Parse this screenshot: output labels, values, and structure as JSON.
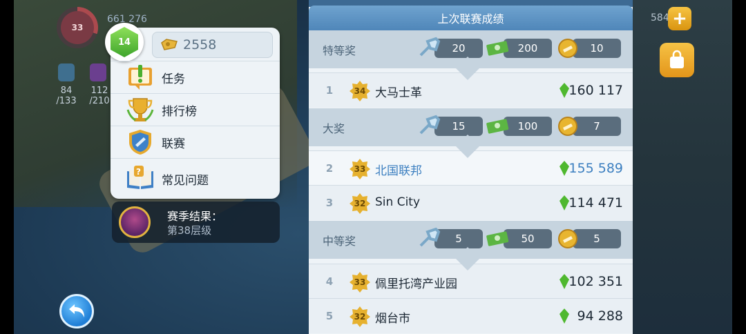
{
  "hud": {
    "player_ring_value": "33",
    "population": "661 276",
    "water_value": "84",
    "water_cap": "/133",
    "power_value": "112",
    "power_cap": "/210",
    "right_counter": "584"
  },
  "menu": {
    "level": "14",
    "currency_value": "2558",
    "items": [
      {
        "label": "任务",
        "icon": "task-icon"
      },
      {
        "label": "排行榜",
        "icon": "trophy-icon"
      },
      {
        "label": "联赛",
        "icon": "league-shield-icon"
      },
      {
        "label": "常见问题",
        "icon": "faq-book-icon"
      }
    ]
  },
  "season": {
    "title": "赛季结果：",
    "result": "第38层级"
  },
  "panel": {
    "title": "上次联赛成绩",
    "tiers": [
      {
        "name": "特等奖",
        "rewards": [
          "20",
          "200",
          "10"
        ]
      },
      {
        "name": "大奖",
        "rewards": [
          "15",
          "100",
          "7"
        ]
      },
      {
        "name": "中等奖",
        "rewards": [
          "5",
          "50",
          "5"
        ]
      }
    ],
    "rows": [
      {
        "rank": "1",
        "level": "34",
        "city": "大马士革",
        "score": "160 117",
        "highlight": false
      },
      {
        "rank": "2",
        "level": "33",
        "city": "北国联邦",
        "score": "155 589",
        "highlight": true
      },
      {
        "rank": "3",
        "level": "32",
        "city": "Sin City",
        "score": "114 471",
        "highlight": false
      },
      {
        "rank": "4",
        "level": "33",
        "city": "佩里托湾产业园",
        "score": "102 351",
        "highlight": false
      },
      {
        "rank": "5",
        "level": "32",
        "city": "烟台市",
        "score": "94 288",
        "highlight": false
      }
    ]
  },
  "colors": {
    "accent_blue": "#3c7fc0",
    "header_blue": "#5b90c2",
    "gem_green": "#4fb82f",
    "gold": "#e2b340"
  }
}
